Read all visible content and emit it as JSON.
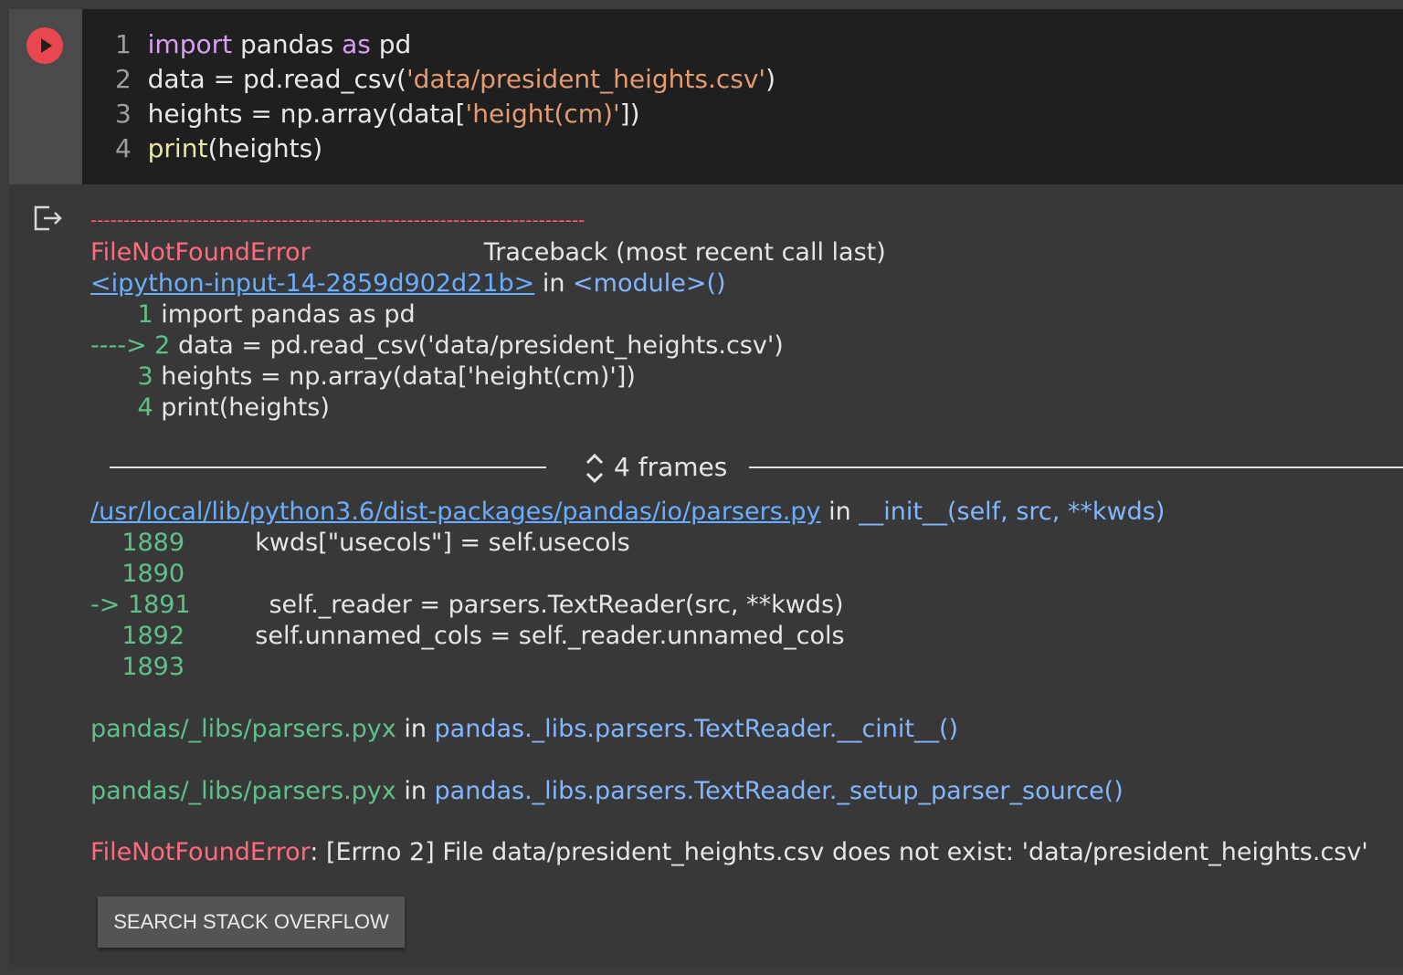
{
  "code": {
    "lines": [
      {
        "num": "1",
        "kw1": "import",
        "mod": " pandas ",
        "kw2": "as",
        "alias": " pd"
      },
      {
        "num": "2",
        "pre": "data = pd.read_csv(",
        "str": "'data/president_heights.csv'",
        "post": ")"
      },
      {
        "num": "3",
        "pre": "heights = np.array(data[",
        "str": "'height(cm)'",
        "post": "])"
      },
      {
        "num": "4",
        "fn": "print",
        "post": "(heights)"
      }
    ]
  },
  "traceback": {
    "separator": "---------------------------------------------------------------------------",
    "error_type": "FileNotFoundError",
    "header": "Traceback (most recent call last)",
    "input_link": "<ipython-input-14-2859d902d21b>",
    "in_word": " in ",
    "module": "<module>()",
    "context": [
      {
        "prefix": "      1 ",
        "text": "import pandas as pd"
      },
      {
        "prefix": "----> 2 ",
        "text": "data = pd.read_csv('data/president_heights.csv')"
      },
      {
        "prefix": "      3 ",
        "text": "heights = np.array(data['height(cm)'])"
      },
      {
        "prefix": "      4 ",
        "text": "print(heights)"
      }
    ],
    "frames_label": "4 frames",
    "frame_file": "/usr/local/lib/python3.6/dist-packages/pandas/io/parsers.py",
    "frame_func": "__init__(self, src, **kwds)",
    "frame_lines": [
      {
        "prefix": "    1889 ",
        "text": "        kwds[\"usecols\"] = self.usecols"
      },
      {
        "prefix": "    1890 ",
        "text": ""
      },
      {
        "prefix": "-> 1891 ",
        "text": "         self._reader = parsers.TextReader(src, **kwds)"
      },
      {
        "prefix": "    1892 ",
        "text": "        self.unnamed_cols = self._reader.unnamed_cols"
      },
      {
        "prefix": "    1893 ",
        "text": ""
      }
    ],
    "pyx1_file": "pandas/_libs/parsers.pyx",
    "pyx1_func": "pandas._libs.parsers.TextReader.__cinit__()",
    "pyx2_file": "pandas/_libs/parsers.pyx",
    "pyx2_func": "pandas._libs.parsers.TextReader._setup_parser_source()",
    "final_error_type": "FileNotFoundError",
    "final_message": ": [Errno 2] File data/president_heights.csv does not exist: 'data/president_heights.csv'"
  },
  "search_button": "SEARCH STACK OVERFLOW",
  "colors": {
    "error_red": "#ff6b7d",
    "green": "#5fc189",
    "blue": "#82b6ff",
    "run_button": "#e8474f"
  }
}
